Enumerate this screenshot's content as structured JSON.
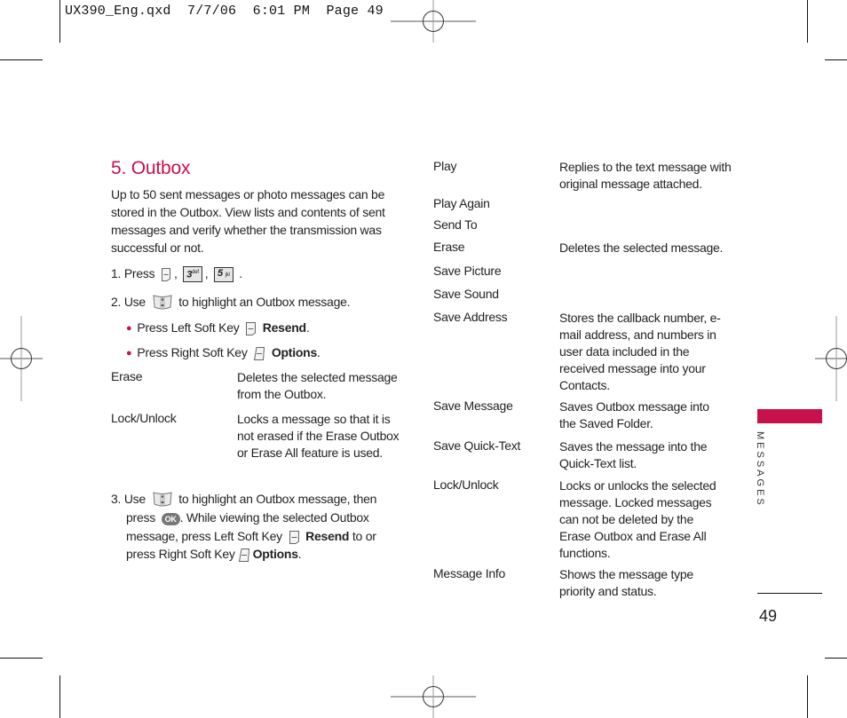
{
  "slug": {
    "text": "UX390_Eng.qxd  7/7/06  6:01 PM  Page 49"
  },
  "section": {
    "title": "5. Outbox",
    "intro": "Up to 50 sent messages or photo messages can be stored in the Outbox. View lists and contents of sent messages and verify whether the transmission was successful or not.",
    "step1": {
      "prefix": "1. Press",
      "sep1": ",",
      "sep2": ",",
      "suffix": ".",
      "key1": "3",
      "key1_sub": "def",
      "key2": "5",
      "key2_sub": "jkl"
    },
    "step2": {
      "prefix": "2. Use",
      "suffix": "to highlight an Outbox message."
    },
    "bullets": [
      {
        "text": "Press Left Soft Key",
        "action": "Resend",
        "end": "."
      },
      {
        "text": "Press Right Soft Key",
        "action": "Options",
        "end": "."
      }
    ],
    "options": [
      {
        "term": "Erase",
        "desc": "Deletes the selected message from the Outbox."
      },
      {
        "term": "Lock/Unlock",
        "desc": "Locks a message so that it is not erased if the Erase Outbox or Erase All feature is used."
      }
    ],
    "step3": {
      "prefix": "3. Use",
      "part1": "to highlight an Outbox message, then",
      "part2": "press",
      "ok_label": "OK",
      "part3": ". While viewing the selected Outbox",
      "part4": "message, press Left Soft Key",
      "resend": "Resend",
      "part5": "to or",
      "part6": "press Right Soft Key",
      "options": "Options",
      "end": "."
    }
  },
  "right_options": [
    {
      "term": "Play",
      "desc": "Replies to the text message with original message attached."
    },
    {
      "term": "Play Again",
      "desc": ""
    },
    {
      "term": "Send To",
      "desc": ""
    },
    {
      "term": "Erase",
      "desc": "Deletes the selected message."
    },
    {
      "term": "Save Picture",
      "desc": ""
    },
    {
      "term": "Save Sound",
      "desc": ""
    },
    {
      "term": "Save Address",
      "desc": "Stores the callback number, e-mail address, and numbers in user data included in the received message into your Contacts."
    },
    {
      "term": "Save Message",
      "desc": "Saves Outbox message into the Saved Folder."
    },
    {
      "term": "Save Quick-Text",
      "desc": "Saves the message into the Quick-Text list."
    },
    {
      "term": "Lock/Unlock",
      "desc": "Locks or unlocks the selected message. Locked messages can not be deleted by the Erase Outbox and Erase All functions."
    },
    {
      "term": "Message Info",
      "desc": "Shows the message type priority and status."
    }
  ],
  "side": {
    "chapter": "MESSAGES",
    "page_number": "49",
    "accent": "#c8104a"
  }
}
